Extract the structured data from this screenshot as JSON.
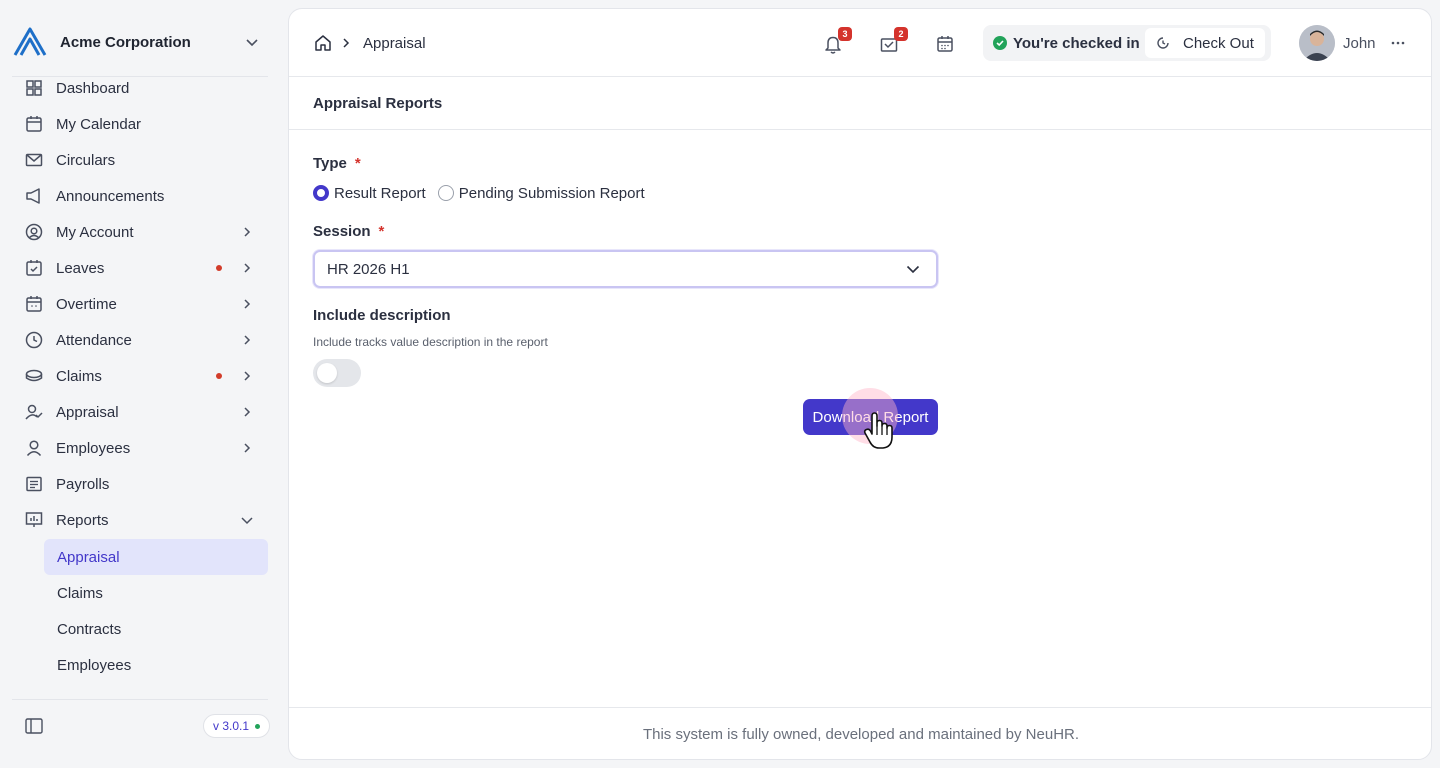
{
  "org": {
    "name": "Acme Corporation",
    "logo_icon": "company-logo-icon"
  },
  "sidebar": {
    "items": [
      {
        "label": "Dashboard",
        "icon": "dashboard-icon",
        "arrow": false,
        "dot": false
      },
      {
        "label": "My Calendar",
        "icon": "calendar-icon",
        "arrow": false,
        "dot": false
      },
      {
        "label": "Circulars",
        "icon": "mail-icon",
        "arrow": false,
        "dot": false
      },
      {
        "label": "Announcements",
        "icon": "megaphone-icon",
        "arrow": false,
        "dot": false
      },
      {
        "label": "My Account",
        "icon": "account-circle-icon",
        "arrow": true,
        "dot": false
      },
      {
        "label": "Leaves",
        "icon": "calendar-check-icon",
        "arrow": true,
        "dot": true
      },
      {
        "label": "Overtime",
        "icon": "calendar-clock-icon",
        "arrow": true,
        "dot": false
      },
      {
        "label": "Attendance",
        "icon": "clock-icon",
        "arrow": true,
        "dot": false
      },
      {
        "label": "Claims",
        "icon": "coins-icon",
        "arrow": true,
        "dot": true
      },
      {
        "label": "Appraisal",
        "icon": "user-check-icon",
        "arrow": true,
        "dot": false
      },
      {
        "label": "Employees",
        "icon": "user-icon",
        "arrow": true,
        "dot": false
      },
      {
        "label": "Payrolls",
        "icon": "receipt-icon",
        "arrow": false,
        "dot": false
      },
      {
        "label": "Reports",
        "icon": "presentation-chart-icon",
        "arrow": false,
        "dot": false,
        "expanded": true
      }
    ],
    "report_subitems": [
      {
        "label": "Appraisal",
        "active": true
      },
      {
        "label": "Claims",
        "active": false
      },
      {
        "label": "Contracts",
        "active": false
      },
      {
        "label": "Employees",
        "active": false
      }
    ],
    "version": "v 3.0.1"
  },
  "breadcrumb": {
    "current": "Appraisal"
  },
  "topbar": {
    "notifications_count": "3",
    "tasks_count": "2",
    "checkin_status": "You're checked in",
    "checkout_label": "Check Out",
    "user_name": "John"
  },
  "section": {
    "title": "Appraisal Reports"
  },
  "form": {
    "type_label": "Type",
    "required_mark": "*",
    "type_options": [
      {
        "label": "Result Report",
        "checked": true
      },
      {
        "label": "Pending Submission Report",
        "checked": false
      }
    ],
    "session_label": "Session",
    "session_value": "HR 2026 H1",
    "include_description_label": "Include description",
    "include_description_hint": "Include tracks value description in the report",
    "include_description_enabled": false,
    "download_label": "Download Report"
  },
  "footer": {
    "text": "This system is fully owned, developed and maintained by NeuHR."
  },
  "colors": {
    "accent": "#4338ca",
    "badge": "#d4332c",
    "success": "#22a35a"
  }
}
